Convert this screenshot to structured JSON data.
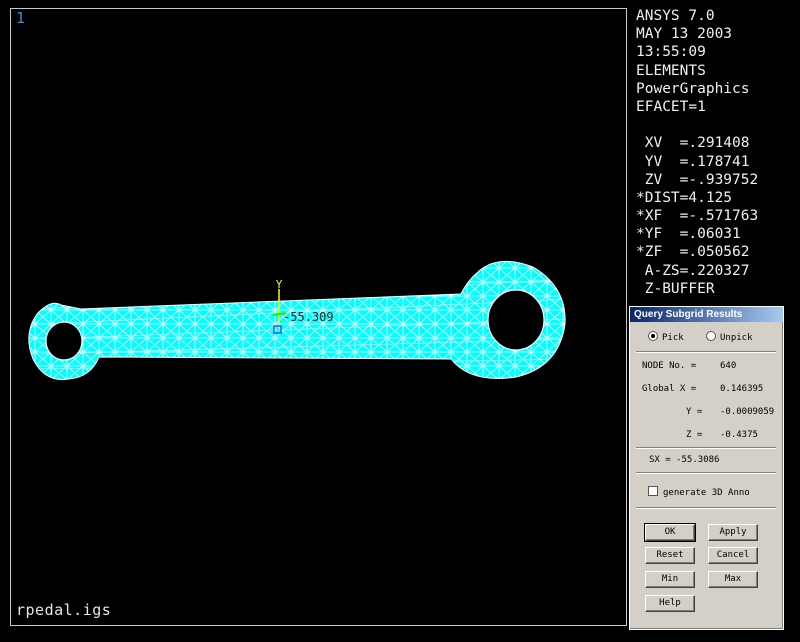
{
  "viewport": {
    "window_number": "1",
    "file_label": "rpedal.igs",
    "triad_label": "Y",
    "value_annotation": "-55.309",
    "mesh_color": "#00ffff"
  },
  "info_panel": {
    "lines": [
      "ANSYS 7.0",
      "MAY 13 2003",
      "13:55:09",
      "ELEMENTS",
      "PowerGraphics",
      "EFACET=1",
      "",
      " XV  =.291408",
      " YV  =.178741",
      " ZV  =-.939752",
      "*DIST=4.125",
      "*XF  =-.571763",
      "*YF  =.06031",
      "*ZF  =.050562",
      " A-ZS=.220327",
      " Z-BUFFER"
    ]
  },
  "dialog": {
    "title": "Query Subgrid Results",
    "pick_label": "Pick",
    "unpick_label": "Unpick",
    "node_label": "NODE No. =",
    "node_value": "640",
    "global_x_label": "Global X =",
    "global_x_value": "0.146395",
    "y_label": "Y =",
    "y_value": "-0.0009059",
    "z_label": "Z =",
    "z_value": "-0.4375",
    "sx_text": "SX = -55.3086",
    "anno_label": "generate 3D Anno",
    "buttons": {
      "ok": "OK",
      "apply": "Apply",
      "reset": "Reset",
      "cancel": "Cancel",
      "min": "Min",
      "max": "Max",
      "help": "Help"
    }
  }
}
